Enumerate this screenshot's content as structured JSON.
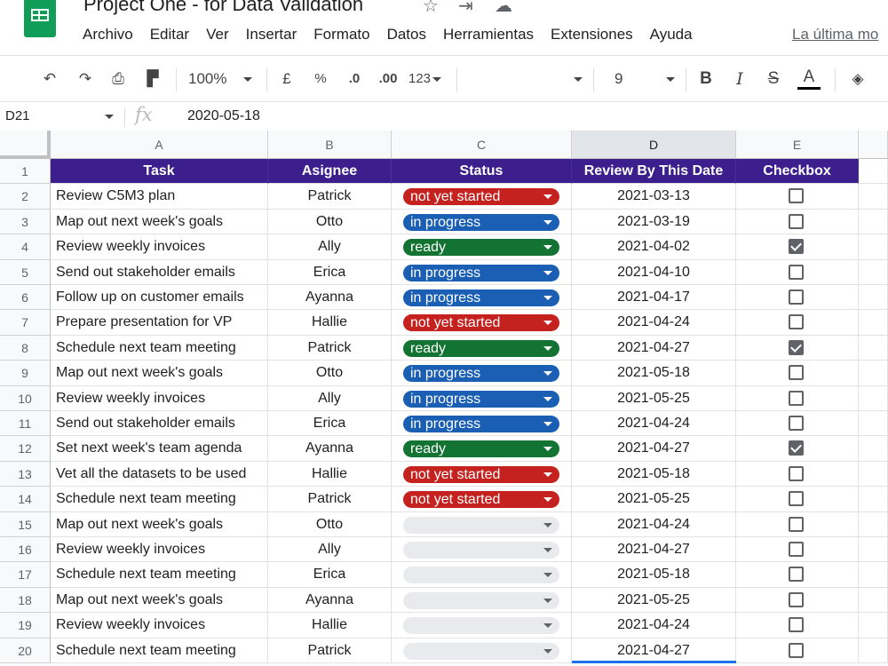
{
  "doc_title": "Project One - for Data Validation",
  "menu": [
    "Archivo",
    "Editar",
    "Ver",
    "Insertar",
    "Formato",
    "Datos",
    "Herramientas",
    "Extensiones",
    "Ayuda"
  ],
  "last_edit": "La última mo",
  "toolbar": {
    "zoom": "100%",
    "currency": "£",
    "percent": "%",
    "decrease_decimals": ".0",
    "increase_decimals": ".00",
    "more_formats": "123",
    "font_size": "9",
    "bold": "B",
    "italic": "I",
    "strikethrough": "S",
    "text_color": "A"
  },
  "formula_bar": {
    "cell_ref": "D21",
    "fx": "fx",
    "value": "2020-05-18"
  },
  "columns": [
    "A",
    "B",
    "C",
    "D",
    "E"
  ],
  "selected_column": "D",
  "header_row": {
    "task": "Task",
    "assignee": "Asignee",
    "status": "Status",
    "date": "Review By This Date",
    "checkbox": "Checkbox"
  },
  "status_colors": {
    "not yet started": "#c5221f",
    "in progress": "#1a5fb4",
    "ready": "#137333",
    "": "#e8eaed"
  },
  "rows": [
    {
      "n": "2",
      "task": "Review C5M3 plan",
      "assignee": "Patrick",
      "status": "not yet started",
      "date": "2021-03-13",
      "checked": false
    },
    {
      "n": "3",
      "task": "Map out next week's goals",
      "assignee": "Otto",
      "status": "in progress",
      "date": "2021-03-19",
      "checked": false
    },
    {
      "n": "4",
      "task": "Review weekly invoices",
      "assignee": "Ally",
      "status": "ready",
      "date": "2021-04-02",
      "checked": true
    },
    {
      "n": "5",
      "task": "Send out stakeholder emails",
      "assignee": "Erica",
      "status": "in progress",
      "date": "2021-04-10",
      "checked": false
    },
    {
      "n": "6",
      "task": "Follow up on customer emails",
      "assignee": "Ayanna",
      "status": "in progress",
      "date": "2021-04-17",
      "checked": false
    },
    {
      "n": "7",
      "task": "Prepare presentation for VP",
      "assignee": "Hallie",
      "status": "not yet started",
      "date": "2021-04-24",
      "checked": false
    },
    {
      "n": "8",
      "task": "Schedule next team meeting",
      "assignee": "Patrick",
      "status": "ready",
      "date": "2021-04-27",
      "checked": true
    },
    {
      "n": "9",
      "task": "Map out next week's goals",
      "assignee": "Otto",
      "status": "in progress",
      "date": "2021-05-18",
      "checked": false
    },
    {
      "n": "10",
      "task": "Review weekly invoices",
      "assignee": "Ally",
      "status": "in progress",
      "date": "2021-05-25",
      "checked": false
    },
    {
      "n": "11",
      "task": "Send out stakeholder emails",
      "assignee": "Erica",
      "status": "in progress",
      "date": "2021-04-24",
      "checked": false
    },
    {
      "n": "12",
      "task": "Set next week's team agenda",
      "assignee": "Ayanna",
      "status": "ready",
      "date": "2021-04-27",
      "checked": true
    },
    {
      "n": "13",
      "task": "Vet all the datasets to be used",
      "assignee": "Hallie",
      "status": "not yet started",
      "date": "2021-05-18",
      "checked": false
    },
    {
      "n": "14",
      "task": "Schedule next team meeting",
      "assignee": "Patrick",
      "status": "not yet started",
      "date": "2021-05-25",
      "checked": false
    },
    {
      "n": "15",
      "task": "Map out next week's goals",
      "assignee": "Otto",
      "status": "",
      "date": "2021-04-24",
      "checked": false
    },
    {
      "n": "16",
      "task": "Review weekly invoices",
      "assignee": "Ally",
      "status": "",
      "date": "2021-04-27",
      "checked": false
    },
    {
      "n": "17",
      "task": "Schedule next team meeting",
      "assignee": "Erica",
      "status": "",
      "date": "2021-05-18",
      "checked": false
    },
    {
      "n": "18",
      "task": "Map out next week's goals",
      "assignee": "Ayanna",
      "status": "",
      "date": "2021-05-25",
      "checked": false
    },
    {
      "n": "19",
      "task": "Review weekly invoices",
      "assignee": "Hallie",
      "status": "",
      "date": "2021-04-24",
      "checked": false
    },
    {
      "n": "20",
      "task": "Schedule next team meeting",
      "assignee": "Patrick",
      "status": "",
      "date": "2021-04-27",
      "checked": false
    }
  ]
}
